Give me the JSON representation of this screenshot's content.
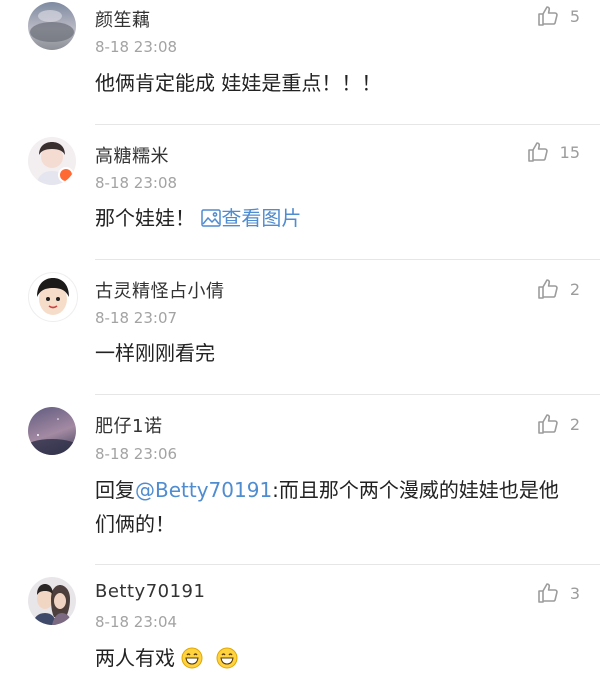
{
  "comments": [
    {
      "name": "颜笙藕",
      "time": "8-18 23:08",
      "text": "他俩肯定能成 娃娃是重点！！！",
      "likes": "5"
    },
    {
      "name": "高糖糯米",
      "time": "8-18 23:08",
      "text": "那个娃娃！",
      "link": "查看图片",
      "likes": "15"
    },
    {
      "name": "古灵精怪占小倩",
      "time": "8-18 23:07",
      "text": "一样刚刚看完",
      "likes": "2"
    },
    {
      "name": "肥仔1诺",
      "time": "8-18 23:06",
      "reply_prefix": "回复",
      "mention": "@Betty70191",
      "text_line1": ":而且那个两个漫威的娃娃也是他",
      "text_line2": "们俩的！",
      "likes": "2"
    },
    {
      "name": "Betty70191",
      "time": "8-18 23:04",
      "text": "两人有戏",
      "likes": "3"
    }
  ],
  "icons": {
    "like": "thumbs-up-icon",
    "image": "image-icon",
    "emoji": "grinning-emoji-icon"
  },
  "colors": {
    "link": "#4f8cd0",
    "meta": "#a3a3a3",
    "divider": "#e6e6e6"
  }
}
